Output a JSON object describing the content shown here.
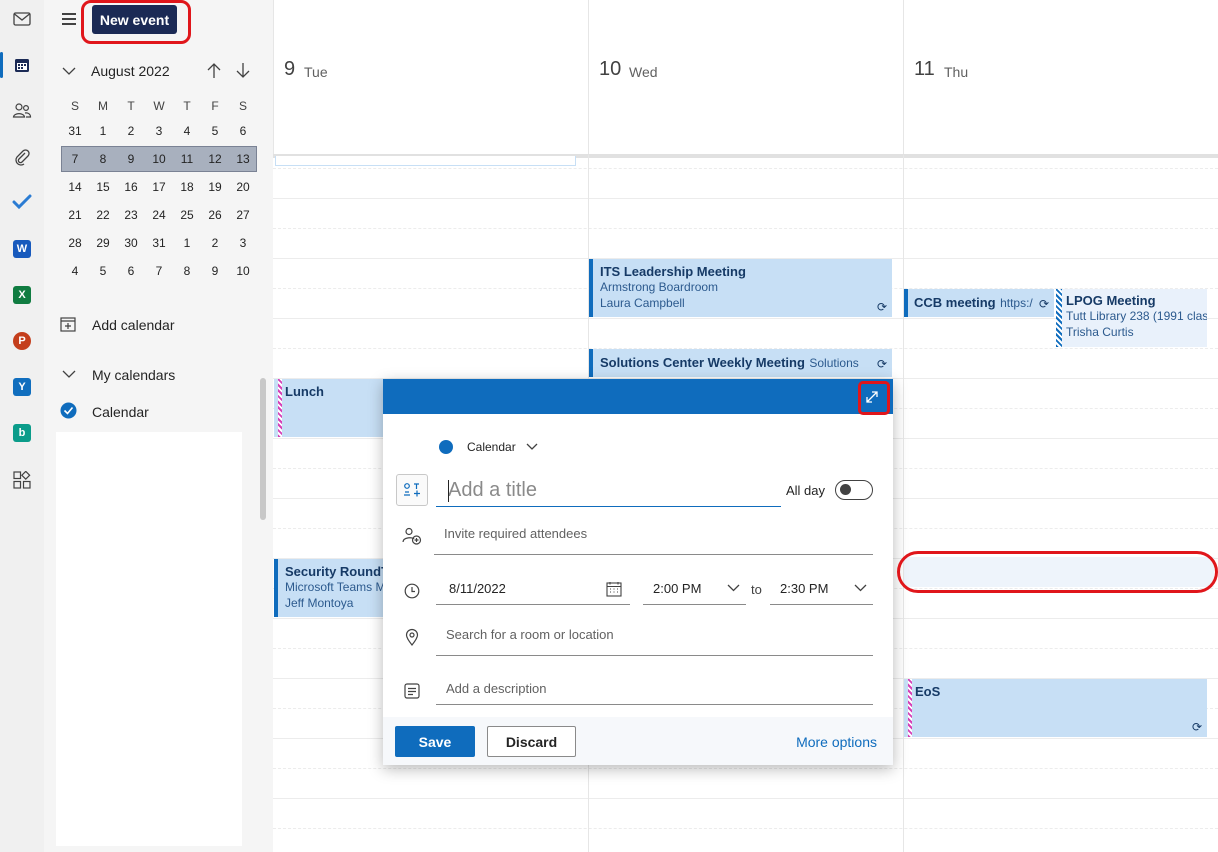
{
  "toolbar": {
    "new_event_label": "New event"
  },
  "mini_calendar": {
    "month_title": "August 2022",
    "days_of_week": [
      "S",
      "M",
      "T",
      "W",
      "T",
      "F",
      "S"
    ],
    "weeks": [
      [
        "31",
        "1",
        "2",
        "3",
        "4",
        "5",
        "6"
      ],
      [
        "7",
        "8",
        "9",
        "10",
        "11",
        "12",
        "13"
      ],
      [
        "14",
        "15",
        "16",
        "17",
        "18",
        "19",
        "20"
      ],
      [
        "21",
        "22",
        "23",
        "24",
        "25",
        "26",
        "27"
      ],
      [
        "28",
        "29",
        "30",
        "31",
        "1",
        "2",
        "3"
      ],
      [
        "4",
        "5",
        "6",
        "7",
        "8",
        "9",
        "10"
      ]
    ],
    "selected_week_index": 1
  },
  "sidebar": {
    "add_calendar_label": "Add calendar",
    "my_calendars_label": "My calendars",
    "calendar_item_label": "Calendar"
  },
  "days": [
    {
      "num": "9",
      "name": "Tue"
    },
    {
      "num": "10",
      "name": "Wed"
    },
    {
      "num": "11",
      "name": "Thu"
    }
  ],
  "events": {
    "its": {
      "title": "ITS Leadership Meeting",
      "line1": "Armstrong Boardroom",
      "line2": "Laura Campbell"
    },
    "ccb": {
      "title": "CCB meeting",
      "extra": "https:/"
    },
    "lpog": {
      "title": "LPOG Meeting",
      "line1": "Tutt Library 238 (1991 clas",
      "line2": "Trisha Curtis"
    },
    "solutions": {
      "title": "Solutions Center Weekly Meeting",
      "extra": "Solutions"
    },
    "lunch": {
      "title": "Lunch"
    },
    "security": {
      "title": "Security RoundT",
      "line1": "Microsoft Teams M",
      "line2": "Jeff Montoya"
    },
    "eos": {
      "title": "EoS"
    }
  },
  "popup": {
    "calendar_label": "Calendar",
    "title_placeholder": "Add a title",
    "allday_label": "All day",
    "attendees_placeholder": "Invite required attendees",
    "date_value": "8/11/2022",
    "start_time": "2:00 PM",
    "to_label": "to",
    "end_time": "2:30 PM",
    "location_placeholder": "Search for a room or location",
    "description_placeholder": "Add a description",
    "save_label": "Save",
    "discard_label": "Discard",
    "more_options_label": "More options"
  },
  "colors": {
    "accent": "#0f6cbd",
    "new_event_bg": "#1b2a55",
    "event_bg": "#c7dff5",
    "annotation": "#e0161b"
  }
}
